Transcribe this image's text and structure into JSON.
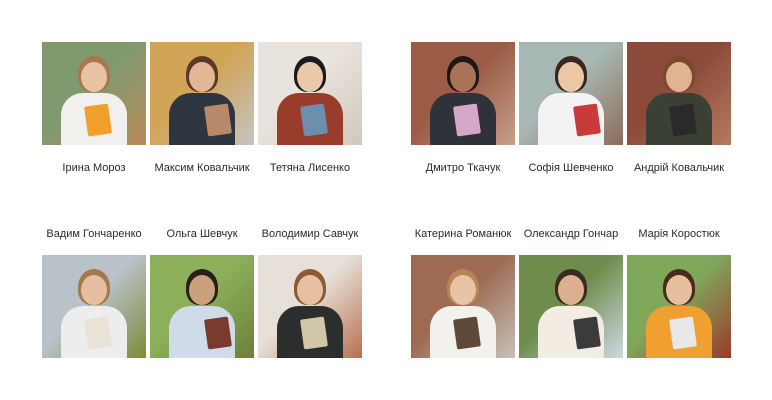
{
  "groups": [
    {
      "id": "top-left",
      "names_position": "below",
      "people": [
        {
          "name": "Ірина Мороз",
          "photo": {
            "bg": "#7f9a6f",
            "bg2": "#b98b5a",
            "skin": "#e7c3a4",
            "hair": "#a8784a",
            "shirt": "#f1f0ee",
            "book": "#f0a02a"
          }
        },
        {
          "name": "Максим Ковальчик",
          "photo": {
            "bg": "#d2a458",
            "bg2": "#c4c4c4",
            "skin": "#e2b796",
            "hair": "#5a3a24",
            "shirt": "#2c3540",
            "book": "#b98a6a"
          }
        },
        {
          "name": "Тетяна Лисенко",
          "photo": {
            "bg": "#e8e3dc",
            "bg2": "#cfc8bd",
            "skin": "#e9c9aa",
            "hair": "#1c1a1a",
            "shirt": "#9a3c2c",
            "book": "#6c8fb0"
          }
        }
      ]
    },
    {
      "id": "top-right",
      "names_position": "below",
      "people": [
        {
          "name": "Дмитро Ткачук",
          "photo": {
            "bg": "#9b5b45",
            "bg2": "#c6a08a",
            "skin": "#a9735a",
            "hair": "#1e1715",
            "shirt": "#2f3238",
            "book": "#d6a7c9"
          }
        },
        {
          "name": "Софія Шевченко",
          "photo": {
            "bg": "#a7b7b3",
            "bg2": "#8b6c5a",
            "skin": "#ebc7a7",
            "hair": "#3a261b",
            "shirt": "#f3f3f3",
            "book": "#c93a3a"
          }
        },
        {
          "name": "Андрій Ковальчик",
          "photo": {
            "bg": "#8b4a3a",
            "bg2": "#b47b5f",
            "skin": "#e0b393",
            "hair": "#7a4a2c",
            "shirt": "#3a4034",
            "book": "#2a2a2a"
          }
        }
      ]
    },
    {
      "id": "bottom-left",
      "names_position": "above",
      "people": [
        {
          "name": "Вадим Гончаренко",
          "photo": {
            "bg": "#b9c2c8",
            "bg2": "#7d8b3c",
            "skin": "#e5bf9f",
            "hair": "#a07a4b",
            "shirt": "#ededed",
            "book": "#e8e2d7"
          }
        },
        {
          "name": "Ольга Шевчук",
          "photo": {
            "bg": "#8cb05a",
            "bg2": "#6c7f3b",
            "skin": "#caa07d",
            "hair": "#2a1e18",
            "shirt": "#cfdbe7",
            "book": "#7a3b2c"
          }
        },
        {
          "name": "Володимир Савчук",
          "photo": {
            "bg": "#e6e0d8",
            "bg2": "#b87050",
            "skin": "#e6c0a0",
            "hair": "#8a5a35",
            "shirt": "#2b2e2c",
            "book": "#d1c6a6"
          }
        }
      ]
    },
    {
      "id": "bottom-right",
      "names_position": "above",
      "people": [
        {
          "name": "Катерина Романюк",
          "photo": {
            "bg": "#9d6a52",
            "bg2": "#c7c1b8",
            "skin": "#e8c4a6",
            "hair": "#b88458",
            "shirt": "#f3f1ec",
            "book": "#5f4a3a"
          }
        },
        {
          "name": "Олександр Гончар",
          "photo": {
            "bg": "#6f8c4d",
            "bg2": "#cfd8e0",
            "skin": "#dcb08f",
            "hair": "#3a2a20",
            "shirt": "#f2ece2",
            "book": "#3b3b3b"
          }
        },
        {
          "name": "Марія Коростюк",
          "photo": {
            "bg": "#7fa85b",
            "bg2": "#9a3b2c",
            "skin": "#e6bf9f",
            "hair": "#4a2a1c",
            "shirt": "#f0a030",
            "book": "#e8e8ea"
          }
        }
      ]
    }
  ]
}
